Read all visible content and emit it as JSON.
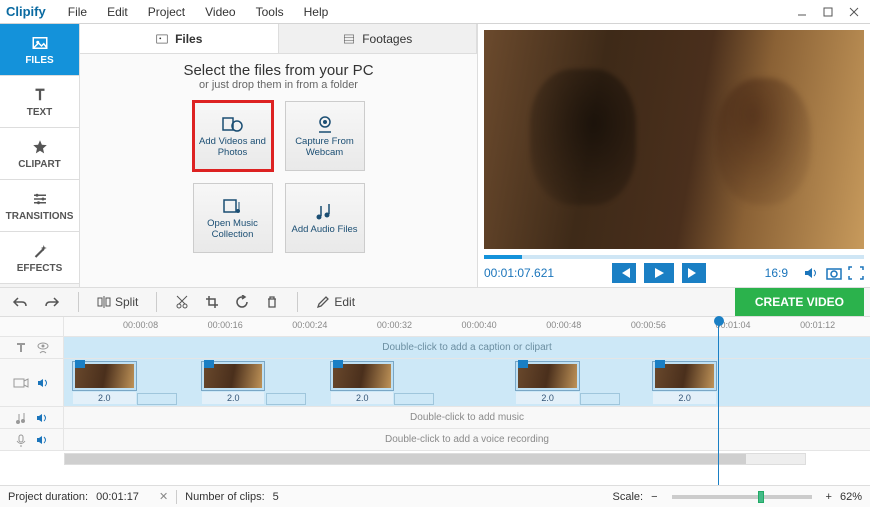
{
  "app": {
    "name": "Clipify"
  },
  "menu": {
    "items": [
      "File",
      "Edit",
      "Project",
      "Video",
      "Tools",
      "Help"
    ]
  },
  "sidebar": {
    "items": [
      {
        "label": "FILES",
        "icon": "image"
      },
      {
        "label": "TEXT",
        "icon": "text"
      },
      {
        "label": "CLIPART",
        "icon": "star"
      },
      {
        "label": "TRANSITIONS",
        "icon": "sliders"
      },
      {
        "label": "EFFECTS",
        "icon": "wand"
      }
    ]
  },
  "filepanel": {
    "tabs": {
      "files": "Files",
      "footages": "Footages"
    },
    "hint_title": "Select the files from your PC",
    "hint_sub": "or just drop them in from a folder",
    "tiles": {
      "addmedia": "Add Videos and Photos",
      "webcam": "Capture From Webcam",
      "music": "Open Music Collection",
      "audio": "Add Audio Files"
    }
  },
  "preview": {
    "timecode": "00:01:07.621",
    "aspect": "16:9"
  },
  "toolbar": {
    "split": "Split",
    "edit": "Edit",
    "create": "CREATE VIDEO"
  },
  "ruler": [
    "00:00:08",
    "00:00:16",
    "00:00:24",
    "00:00:32",
    "00:00:40",
    "00:00:48",
    "00:00:56",
    "00:01:04",
    "00:01:12"
  ],
  "tracks": {
    "caption_hint": "Double-click to add a caption or clipart",
    "audio_hint": "Double-click to add music",
    "voice_hint": "Double-click to add a voice recording",
    "clip_durations": [
      "2.0",
      "2.0",
      "2.0",
      "2.0",
      "2.0"
    ]
  },
  "status": {
    "duration_label": "Project duration:",
    "duration_value": "00:01:17",
    "clips_label": "Number of clips:",
    "clips_value": "5",
    "scale_label": "Scale:",
    "scale_value": "62%"
  }
}
